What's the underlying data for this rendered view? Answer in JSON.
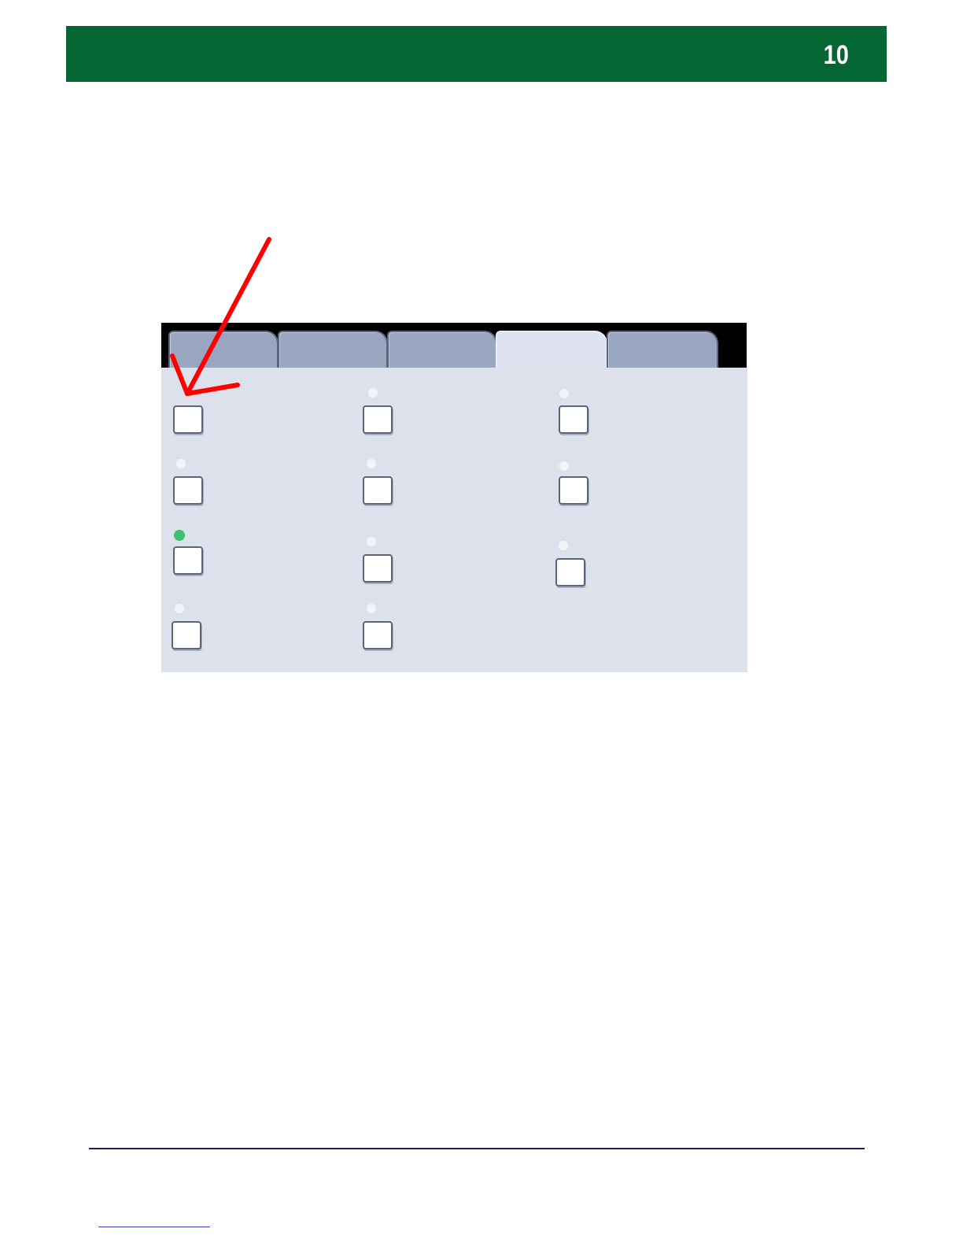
{
  "header": {
    "page_number": "10",
    "bar_color": "#036633"
  },
  "screen": {
    "tabs": [
      {
        "id": "tab-1",
        "active": false
      },
      {
        "id": "tab-2",
        "active": false
      },
      {
        "id": "tab-3",
        "active": false
      },
      {
        "id": "tab-4",
        "active": true
      },
      {
        "id": "tab-5",
        "active": false
      }
    ],
    "options": [
      {
        "id": "option-1",
        "indicator": "none"
      },
      {
        "id": "option-2",
        "indicator": "off"
      },
      {
        "id": "option-3",
        "indicator": "off"
      },
      {
        "id": "option-4",
        "indicator": "off"
      },
      {
        "id": "option-5",
        "indicator": "off"
      },
      {
        "id": "option-6",
        "indicator": "off"
      },
      {
        "id": "option-7",
        "indicator": "on"
      },
      {
        "id": "option-8",
        "indicator": "off"
      },
      {
        "id": "option-9",
        "indicator": "off"
      },
      {
        "id": "option-10",
        "indicator": "off"
      },
      {
        "id": "option-11",
        "indicator": "off"
      }
    ],
    "colors": {
      "indicator_on": "#3cc06a",
      "indicator_off": "#f2f4f8",
      "panel": "#dce1ec",
      "tab_inactive": "#9aa5c0",
      "tab_active": "#dde2ee"
    }
  },
  "annotation": {
    "type": "red-arrow",
    "target": "option-1",
    "color": "#ff0000"
  }
}
